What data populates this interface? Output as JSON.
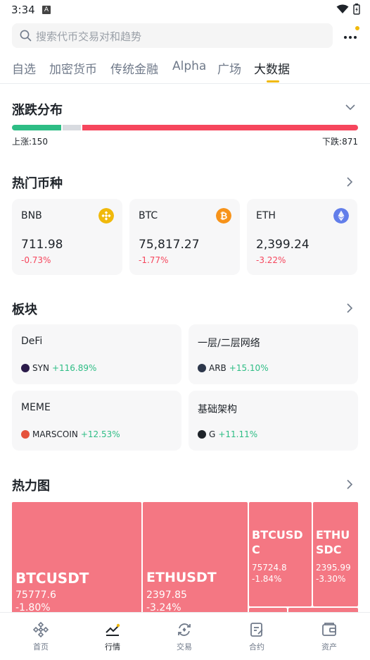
{
  "status_bar": {
    "time": "3:34",
    "notif_letter": "A"
  },
  "search": {
    "placeholder": "搜索代币交易对和趋势"
  },
  "tabs": [
    {
      "label": "自选"
    },
    {
      "label": "加密货币"
    },
    {
      "label": "传统金融"
    },
    {
      "label": "Alpha"
    },
    {
      "label": "广场"
    },
    {
      "label": "大数据",
      "active": true
    }
  ],
  "distribution": {
    "title": "涨跌分布",
    "up_label": "上涨:150",
    "down_label": "下跌:871",
    "up_count": 150,
    "down_count": 871
  },
  "hot_coins": {
    "title": "热门币种",
    "items": [
      {
        "symbol": "BNB",
        "price": "711.98",
        "change": "-0.73%",
        "icon": "bnb-icon",
        "color": "#f0b90b"
      },
      {
        "symbol": "BTC",
        "price": "75,817.27",
        "change": "-1.77%",
        "icon": "btc-icon",
        "color": "#f7931a"
      },
      {
        "symbol": "ETH",
        "price": "2,399.24",
        "change": "-3.22%",
        "icon": "eth-icon",
        "color": "#627eea"
      }
    ]
  },
  "sectors": {
    "title": "板块",
    "items": [
      {
        "name": "DeFi",
        "token": "SYN",
        "change": "+116.89%",
        "icon_color": "#2b1b4a"
      },
      {
        "name": "一层/二层网络",
        "token": "ARB",
        "change": "+15.10%",
        "icon_color": "#2d374b"
      },
      {
        "name": "MEME",
        "token": "MARSCOIN",
        "change": "+12.53%",
        "icon_color": "#e5533d"
      },
      {
        "name": "基础架构",
        "token": "G",
        "change": "+11.11%",
        "icon_color": "#1e2329"
      }
    ]
  },
  "heatmap": {
    "title": "热力图",
    "cells": [
      {
        "symbol": "BTCUSDT",
        "price": "75777.6",
        "change": "-1.80%"
      },
      {
        "symbol": "ETHUSDT",
        "price": "2397.85",
        "change": "-3.24%"
      },
      {
        "symbol": "BTCUSDC",
        "price": "75724.8",
        "change": "-1.84%"
      },
      {
        "symbol": "ETHUSDC",
        "price": "2395.99",
        "change": "-3.30%"
      }
    ],
    "cell_color": "#f47783"
  },
  "bottom_nav": [
    {
      "label": "首页",
      "icon": "home-icon"
    },
    {
      "label": "行情",
      "icon": "markets-icon",
      "active": true
    },
    {
      "label": "交易",
      "icon": "trade-icon"
    },
    {
      "label": "合约",
      "icon": "futures-icon"
    },
    {
      "label": "资产",
      "icon": "wallet-icon"
    }
  ],
  "colors": {
    "up": "#2ebd85",
    "down": "#f6465d",
    "accent": "#f0b90b"
  }
}
